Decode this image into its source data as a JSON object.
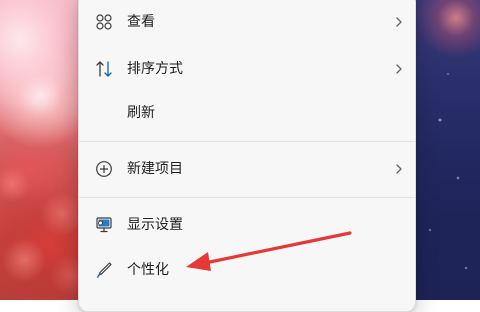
{
  "menu": {
    "items": [
      {
        "label": "查看",
        "icon": "grid-icon",
        "has_submenu": true
      },
      {
        "label": "排序方式",
        "icon": "sort-icon",
        "has_submenu": true
      },
      {
        "label": "刷新",
        "icon": "",
        "has_submenu": false
      },
      {
        "label": "新建项目",
        "icon": "plus-circle-icon",
        "has_submenu": true
      },
      {
        "label": "显示设置",
        "icon": "display-settings-icon",
        "has_submenu": false
      },
      {
        "label": "个性化",
        "icon": "brush-icon",
        "has_submenu": false
      }
    ]
  },
  "colors": {
    "accent_blue": "#0067c0",
    "annotation_red": "#e53935",
    "menu_background": "#f7f7f8"
  }
}
